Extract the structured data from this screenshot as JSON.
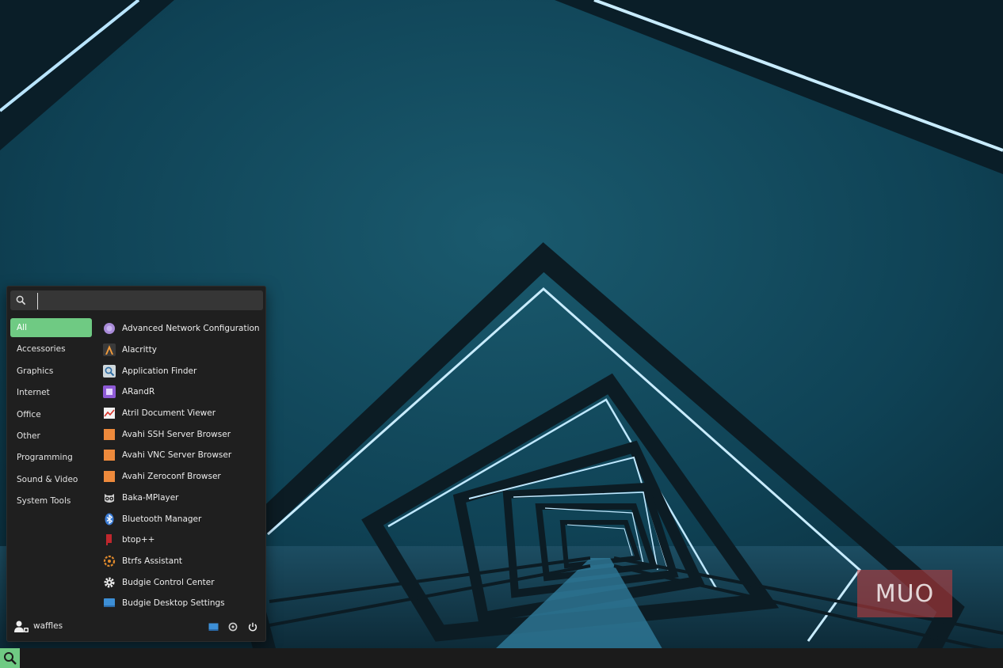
{
  "search": {
    "placeholder": "",
    "value": ""
  },
  "categories": [
    {
      "label": "All",
      "active": true
    },
    {
      "label": "Accessories"
    },
    {
      "label": "Graphics"
    },
    {
      "label": "Internet"
    },
    {
      "label": "Office"
    },
    {
      "label": "Other"
    },
    {
      "label": "Programming"
    },
    {
      "label": "Sound & Video"
    },
    {
      "label": "System Tools"
    }
  ],
  "apps": [
    {
      "label": "Advanced Network Configuration",
      "icon": "network-icon"
    },
    {
      "label": "Alacritty",
      "icon": "alacritty-icon"
    },
    {
      "label": "Application Finder",
      "icon": "magnifier-icon"
    },
    {
      "label": "ARandR",
      "icon": "arandr-icon"
    },
    {
      "label": "Atril Document Viewer",
      "icon": "document-viewer-icon"
    },
    {
      "label": "Avahi SSH Server Browser",
      "icon": "avahi-ssh-icon"
    },
    {
      "label": "Avahi VNC Server Browser",
      "icon": "avahi-vnc-icon"
    },
    {
      "label": "Avahi Zeroconf Browser",
      "icon": "avahi-zeroconf-icon"
    },
    {
      "label": "Baka-MPlayer",
      "icon": "owl-icon"
    },
    {
      "label": "Bluetooth Manager",
      "icon": "bluetooth-icon"
    },
    {
      "label": "btop++",
      "icon": "btop-icon"
    },
    {
      "label": "Btrfs Assistant",
      "icon": "btrfs-icon"
    },
    {
      "label": "Budgie Control Center",
      "icon": "gear-icon"
    },
    {
      "label": "Budgie Desktop Settings",
      "icon": "desktop-settings-icon"
    }
  ],
  "user": {
    "name": "waffles"
  },
  "watermark": {
    "text": "MUO"
  },
  "colors": {
    "accent": "#6fca83",
    "menu_bg": "#1f1f1f",
    "panel_bg": "#1b1b1b"
  }
}
